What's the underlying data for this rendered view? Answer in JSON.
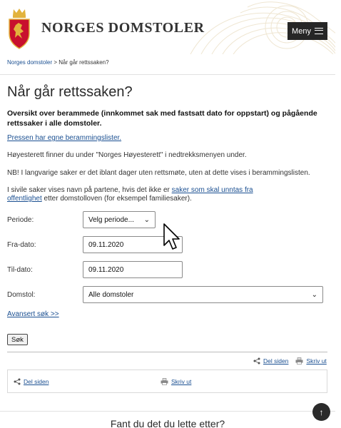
{
  "header": {
    "brand": "NORGES DOMSTOLER",
    "menu_label": "Meny"
  },
  "breadcrumb": {
    "home": "Norges domstoler",
    "separator": ">",
    "current": "Når går rettssaken?"
  },
  "page": {
    "title": "Når går rettssaken?",
    "lead": "Oversikt over berammede (innkommet sak med fastsatt dato for oppstart) og pågående rettssaker i alle domstoler.",
    "press_link": "Pressen har egne berammingslister.",
    "supreme_note": "Høyesterett finner du under \"Norges Høyesterett\" i nedtrekksmenyen under.",
    "long_cases_note": "NB! I langvarige saker er det iblant dager uten rettsmøte, uten at dette vises i berammingslisten.",
    "civil_prefix": "I sivile saker vises navn på partene, hvis det ikke er ",
    "civil_link": "saker som skal unntas fra offentlighet",
    "civil_suffix": " etter domstolloven (for eksempel familiesaker)."
  },
  "form": {
    "period_label": "Periode:",
    "period_value": "Velg periode...",
    "from_label": "Fra-dato:",
    "from_value": "09.11.2020",
    "to_label": "Til-dato:",
    "to_value": "09.11.2020",
    "court_label": "Domstol:",
    "court_value": "Alle domstoler",
    "advanced_link": "Avansert søk >>",
    "submit_label": "Søk"
  },
  "share": {
    "share_label": "Del siden",
    "print_label": "Skriv ut"
  },
  "footer": {
    "question": "Fant du det du lette etter?"
  },
  "colors": {
    "link": "#1a4f91",
    "menu_bg": "#262626",
    "logo_red": "#c8102e",
    "logo_gold": "#e2b33c"
  }
}
